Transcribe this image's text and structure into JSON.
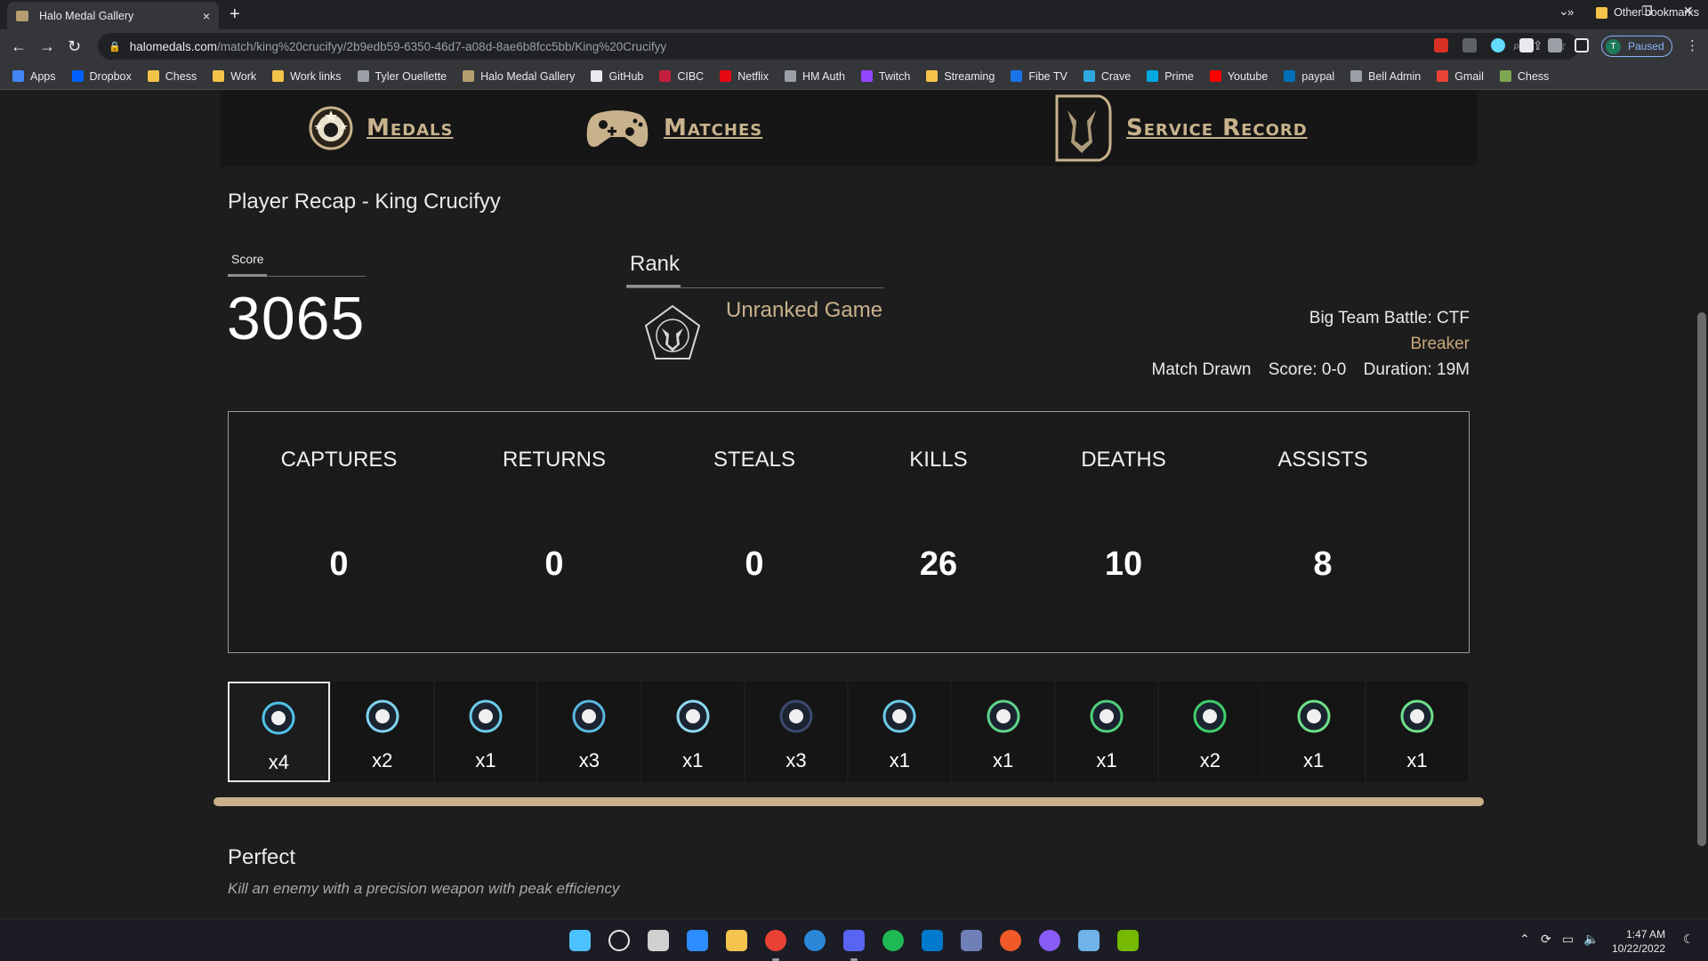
{
  "browser": {
    "tab_title": "Halo Medal Gallery",
    "tab_close": "×",
    "new_tab": "+",
    "url_host": "halomedals.com",
    "url_path": "/match/king%20crucifyy/2b9edb59-6350-46d7-a08d-8ae6b8fcc5bb/King%20Crucifyy",
    "profile_initial": "T",
    "profile_label": "Paused",
    "bookmarks": [
      {
        "label": "Apps",
        "color": "#4285f4"
      },
      {
        "label": "Dropbox",
        "color": "#0061ff"
      },
      {
        "label": "Chess",
        "color": "#f3c34a"
      },
      {
        "label": "Work",
        "color": "#f3c34a"
      },
      {
        "label": "Work links",
        "color": "#f3c34a"
      },
      {
        "label": "Tyler Ouellette",
        "color": "#9aa0a6"
      },
      {
        "label": "Halo Medal Gallery",
        "color": "#b59d6f"
      },
      {
        "label": "GitHub",
        "color": "#e8eaed"
      },
      {
        "label": "CIBC",
        "color": "#c41f3e"
      },
      {
        "label": "Netflix",
        "color": "#e50914"
      },
      {
        "label": "HM Auth",
        "color": "#9aa0a6"
      },
      {
        "label": "Twitch",
        "color": "#9146ff"
      },
      {
        "label": "Streaming",
        "color": "#f3c34a"
      },
      {
        "label": "Fibe TV",
        "color": "#1a73e8"
      },
      {
        "label": "Crave",
        "color": "#2ea7e0"
      },
      {
        "label": "Prime",
        "color": "#00a8e1"
      },
      {
        "label": "Youtube",
        "color": "#ff0000"
      },
      {
        "label": "paypal",
        "color": "#0070ba"
      },
      {
        "label": "Bell Admin",
        "color": "#9aa0a6"
      },
      {
        "label": "Gmail",
        "color": "#ea4335"
      },
      {
        "label": "Chess",
        "color": "#7fa650"
      }
    ],
    "more_bookmarks": "»",
    "other_bookmarks": "Other bookmarks"
  },
  "nav": {
    "medals": "Medals",
    "matches": "Matches",
    "service_record": "Service Record"
  },
  "recap": {
    "title": "Player Recap - King Crucifyy",
    "score_label": "Score",
    "score_value": "3065",
    "rank_label": "Rank",
    "rank_name": "Unranked Game"
  },
  "match": {
    "mode": "Big Team Battle: CTF",
    "map": "Breaker",
    "result": "Match Drawn",
    "score": "Score: 0-0",
    "duration": "Duration: 19M"
  },
  "stats": [
    {
      "name": "CAPTURES",
      "value": "0"
    },
    {
      "name": "RETURNS",
      "value": "0"
    },
    {
      "name": "STEALS",
      "value": "0"
    },
    {
      "name": "KILLS",
      "value": "26"
    },
    {
      "name": "DEATHS",
      "value": "10"
    },
    {
      "name": "ASSISTS",
      "value": "8"
    }
  ],
  "medals": [
    {
      "icon": "perfect-medal-icon",
      "count": "x4",
      "color": "#4fc3e8"
    },
    {
      "icon": "skull-medal-icon",
      "count": "x2",
      "color": "#7fd3f0"
    },
    {
      "icon": "flag-medal-icon",
      "count": "x1",
      "color": "#6ccbe8"
    },
    {
      "icon": "target-medal-icon",
      "count": "x3",
      "color": "#5ab8e0"
    },
    {
      "icon": "sword-medal-icon",
      "count": "x1",
      "color": "#8fd8f0"
    },
    {
      "icon": "star-medal-icon",
      "count": "x3",
      "color": "#3a4a70"
    },
    {
      "icon": "shield-medal-icon",
      "count": "x1",
      "color": "#6ccbe8"
    },
    {
      "icon": "rocket-medal-icon",
      "count": "x1",
      "color": "#5fd38a"
    },
    {
      "icon": "lock-medal-icon",
      "count": "x1",
      "color": "#4fd07a"
    },
    {
      "icon": "ring-medal-icon",
      "count": "x2",
      "color": "#3fcf6a"
    },
    {
      "icon": "sniper-medal-icon",
      "count": "x1",
      "color": "#6fe08a"
    },
    {
      "icon": "rifle-medal-icon",
      "count": "x1",
      "color": "#6fe08a"
    }
  ],
  "selected_medal": {
    "name": "Perfect",
    "description": "Kill an enemy with a precision weapon with peak efficiency"
  },
  "taskbar": {
    "time": "1:47 AM",
    "date": "10/22/2022"
  }
}
